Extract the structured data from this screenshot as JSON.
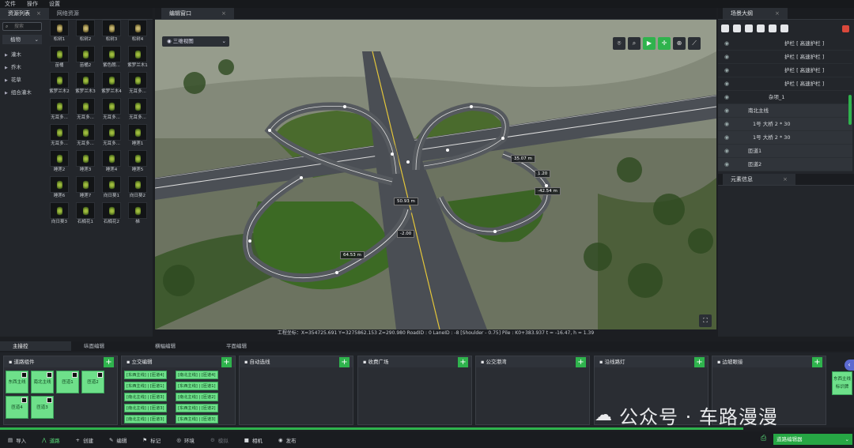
{
  "menu": [
    "文件",
    "操作",
    "设置"
  ],
  "left": {
    "tabs": [
      {
        "label": "资源列表",
        "active": true
      },
      {
        "label": "网络资源",
        "active": false
      }
    ],
    "search_placeholder": "搜索",
    "category_select": "植物",
    "categories": [
      "灌木",
      "乔木",
      "花草",
      "组合灌木"
    ],
    "items": [
      "松树1",
      "松树2",
      "松树3",
      "松树4",
      "苗桶",
      "苗桶2",
      "紫色朗...",
      "紫罗兰木1",
      "紫罗兰木2",
      "紫罗兰木3",
      "紫罗兰木4",
      "无耳多...",
      "无耳多...",
      "无耳多...",
      "无耳多...",
      "无耳多...",
      "无耳多...",
      "无耳多...",
      "无耳多...",
      "睡莲1",
      "睡莲2",
      "睡莲3",
      "睡莲4",
      "睡莲5",
      "睡莲6",
      "睡莲7",
      "向日葵1",
      "向日葵2",
      "向日葵3",
      "石楠花1",
      "石楠花2",
      "梯"
    ]
  },
  "viewport": {
    "tab": "编辑窗口",
    "view_mode": "三维视图",
    "labels": [
      "35.07 m",
      "1.20",
      "-42.54 m",
      "50.93 m",
      "-2.00",
      "64.53 m"
    ],
    "coords": "工程坐标：X=354725.691 Y=3275862.153 Z=290.980  RoadID : 0  LaneID : -8 [Shoulder - 0.75]  Pile : K0+383.937 t = -16.47, h = 1.39"
  },
  "outline": {
    "tab": "场景大纲",
    "rows": [
      "护栏 [ 高速护栏 ]",
      "护栏 [ 高速护栏 ]",
      "护栏 [ 高速护栏 ]",
      "护栏 [ 高速护栏 ]",
      "杂项_1",
      "南北主线",
      "1号 大桥 2 * 30",
      "1号 大桥 2 * 30",
      "匝道1",
      "匝道2"
    ],
    "info_tab": "元素信息"
  },
  "bottom": {
    "tabs": [
      "主接控",
      "纵面编辑",
      "横幅编辑",
      "平面编辑"
    ],
    "panels": [
      "道路组件",
      "立交编辑",
      "自动选线",
      "收费广场",
      "公交港湾",
      "沿线路灯",
      "边坡眼接"
    ],
    "components": [
      "东西主线",
      "南北主线",
      "匝道1",
      "匝道2",
      "匝道4",
      "匝道3"
    ],
    "junctions": [
      "[东西主线] | [匝道4]",
      "[南北主线] | [匝道4]",
      "[东西主线] | [匝道1]",
      "[东西主线] | [匝道1]",
      "[南北主线] | [匝道3]",
      "[南北主线] | [匝道2]",
      "[南北主线] | [匝道3]",
      "[东西主线] | [匝道2]",
      "[南北主线] | [匝道3]",
      "[东西主线] | [匝道3]"
    ],
    "side_btn": "东西主线 标识牌"
  },
  "status": {
    "items": [
      "导入",
      "道路",
      "创建",
      "编辑",
      "标记",
      "环境",
      "模拟",
      "相机",
      "发布"
    ],
    "combo": "道路编辑器"
  },
  "watermark": "公众号 · 车路漫漫"
}
